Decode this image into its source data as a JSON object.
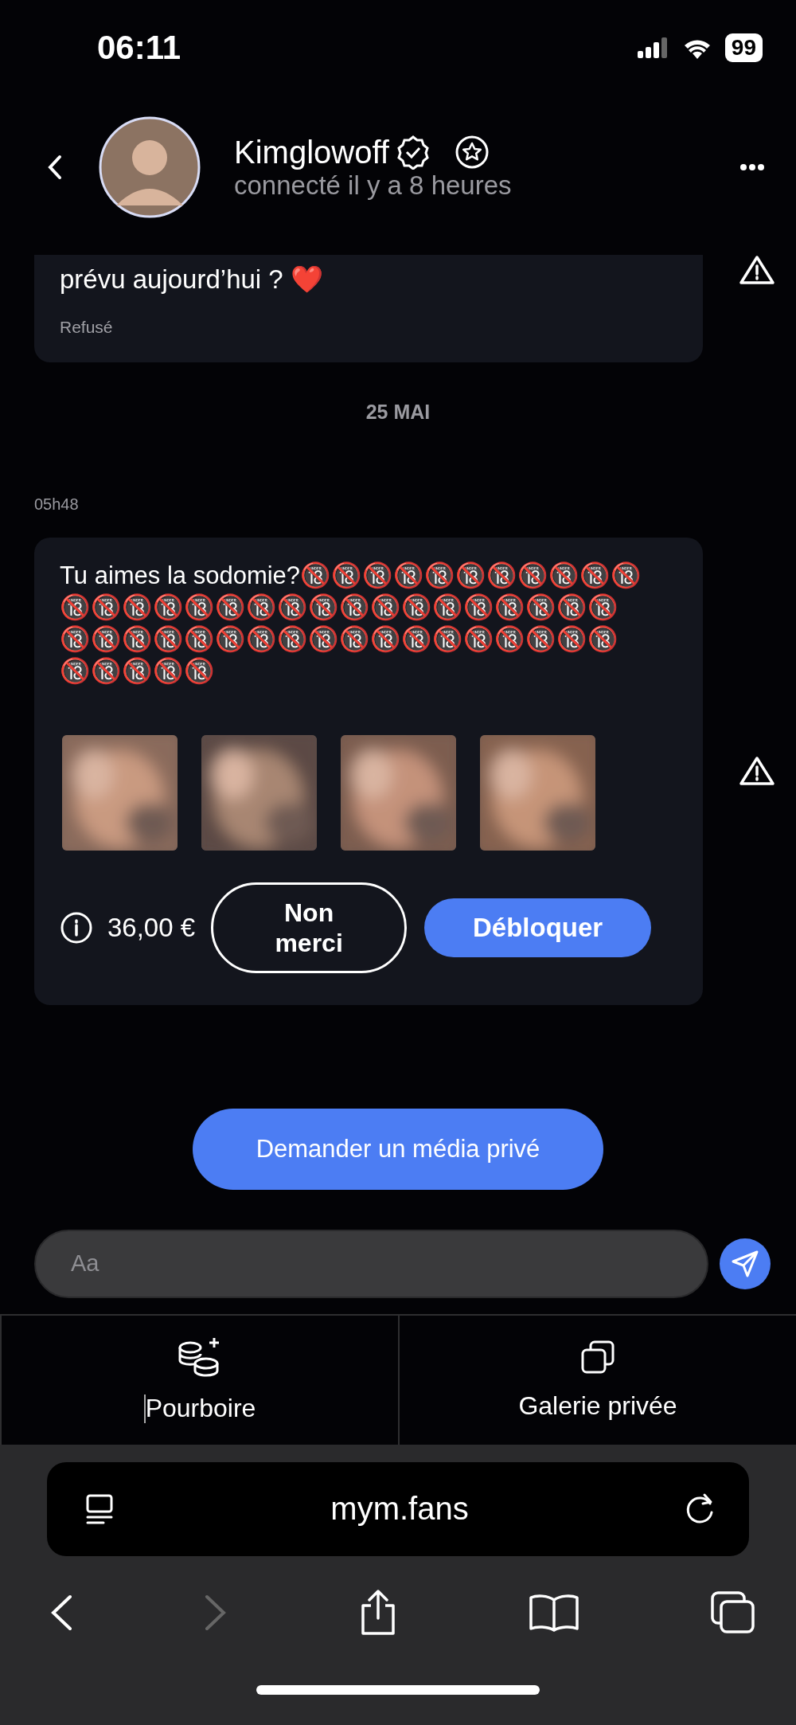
{
  "status_bar": {
    "time": "06:11",
    "battery": "99"
  },
  "header": {
    "name": "Kimglowoff",
    "status": "connecté il y a 8 heures"
  },
  "messages": [
    {
      "kind": "text",
      "text": "prévu aujourd’hui ? ❤️",
      "status": "Refusé",
      "reported": true
    },
    {
      "kind": "date",
      "text": "25 MAI"
    },
    {
      "kind": "media",
      "time": "05h48",
      "text": "Tu aimes la sodomie?🔞🔞🔞🔞🔞🔞🔞🔞🔞🔞🔞🔞🔞🔞🔞🔞🔞🔞🔞🔞🔞🔞🔞🔞🔞🔞🔞🔞🔞🔞🔞🔞🔞🔞🔞🔞🔞🔞🔞🔞🔞🔞🔞🔞🔞🔞🔞🔞🔞🔞🔞🔞",
      "price": "36,00 €",
      "decline": "Non merci",
      "unlock": "Débloquer",
      "reported": true
    }
  ],
  "request_button": "Demander un média privé",
  "composer": {
    "placeholder": "Aa"
  },
  "actions": [
    {
      "kind": "tip",
      "label": "Pourboire",
      "caret": true
    },
    {
      "kind": "gallery",
      "label": "Galerie privée",
      "caret": false
    }
  ],
  "browser": {
    "url": "mym.fans",
    "forward_disabled": true
  }
}
